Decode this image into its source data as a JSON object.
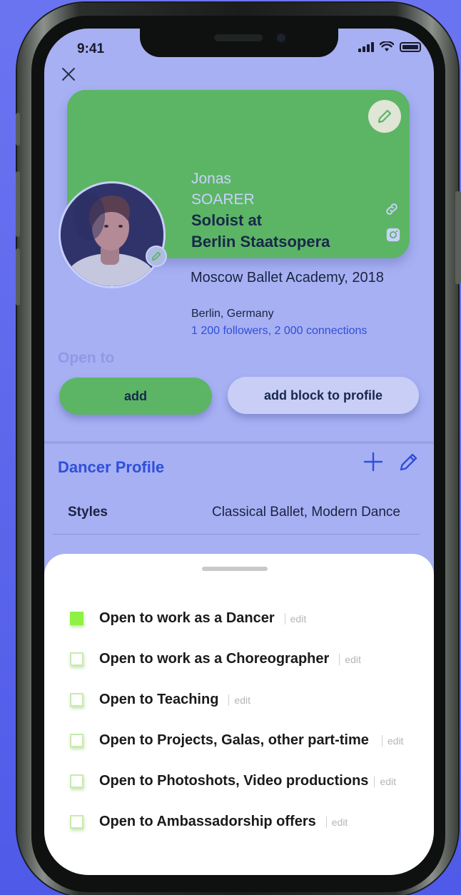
{
  "status_bar": {
    "time": "9:41"
  },
  "profile_card": {
    "first_name": "Jonas",
    "last_name": "SOARER",
    "role_line1": "Soloist at",
    "role_line2": "Berlin Staatsopera",
    "education": "Moscow Ballet Academy, 2018",
    "location": "Berlin, Germany",
    "stats": "1 200 followers, 2 000 connections"
  },
  "open_to_section": {
    "title": "Open to",
    "add_button": "add",
    "add_block_button": "add block to profile"
  },
  "dancer_profile": {
    "title": "Dancer Profile",
    "rows": [
      {
        "label": "Styles",
        "value": "Classical Ballet, Modern Dance"
      }
    ]
  },
  "bottom_sheet": {
    "options": [
      {
        "label": "Open to work as a Dancer",
        "edit": "edit",
        "checked": true
      },
      {
        "label": "Open to work as a Choreographer",
        "edit": "edit",
        "checked": false
      },
      {
        "label": "Open to Teaching",
        "edit": "edit",
        "checked": false
      },
      {
        "label": "Open to Projects, Galas, other part-time",
        "edit": "edit",
        "checked": false
      },
      {
        "label": "Open to Photoshots, Video productions",
        "edit": "edit",
        "checked": false
      },
      {
        "label": "Open to Ambassadorship offers",
        "edit": "edit",
        "checked": false
      }
    ]
  },
  "colors": {
    "screen_bg": "#a7b0f3",
    "card_green": "#5cb565",
    "accent_blue": "#2f4fd8",
    "checkbox_green": "#8ef243"
  }
}
